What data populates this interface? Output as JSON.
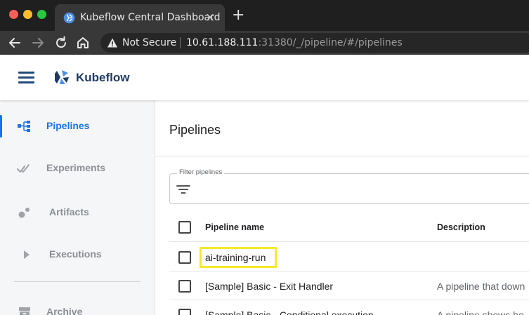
{
  "browser": {
    "tab_title": "Kubeflow Central Dashboard",
    "tab_close": "×",
    "new_tab": "+",
    "security_label": "Not Secure",
    "url_host": "10.61.188.111",
    "url_rest": ":31380/_/pipeline/#/pipelines"
  },
  "header": {
    "app_name": "Kubeflow"
  },
  "sidebar": {
    "items": [
      {
        "label": "Pipelines",
        "icon": "pipeline-icon",
        "active": true
      },
      {
        "label": "Experiments",
        "icon": "experiments-icon",
        "active": false
      },
      {
        "label": "Artifacts",
        "icon": "artifacts-icon",
        "active": false
      },
      {
        "label": "Executions",
        "icon": "executions-icon",
        "active": false
      },
      {
        "label": "Archive",
        "icon": "archive-icon",
        "active": false
      }
    ]
  },
  "main": {
    "title": "Pipelines",
    "filter_label": "Filter pipelines",
    "table": {
      "columns": [
        "Pipeline name",
        "Description"
      ],
      "rows": [
        {
          "name": "ai-training-run",
          "description": ""
        },
        {
          "name": "[Sample] Basic - Exit Handler",
          "description": "A pipeline that down"
        },
        {
          "name": "[Sample] Basic - Conditional execution",
          "description": "A pipeline shows ho"
        }
      ]
    }
  },
  "colors": {
    "accent": "#1a73e8",
    "highlight": "#f5ea2a"
  }
}
